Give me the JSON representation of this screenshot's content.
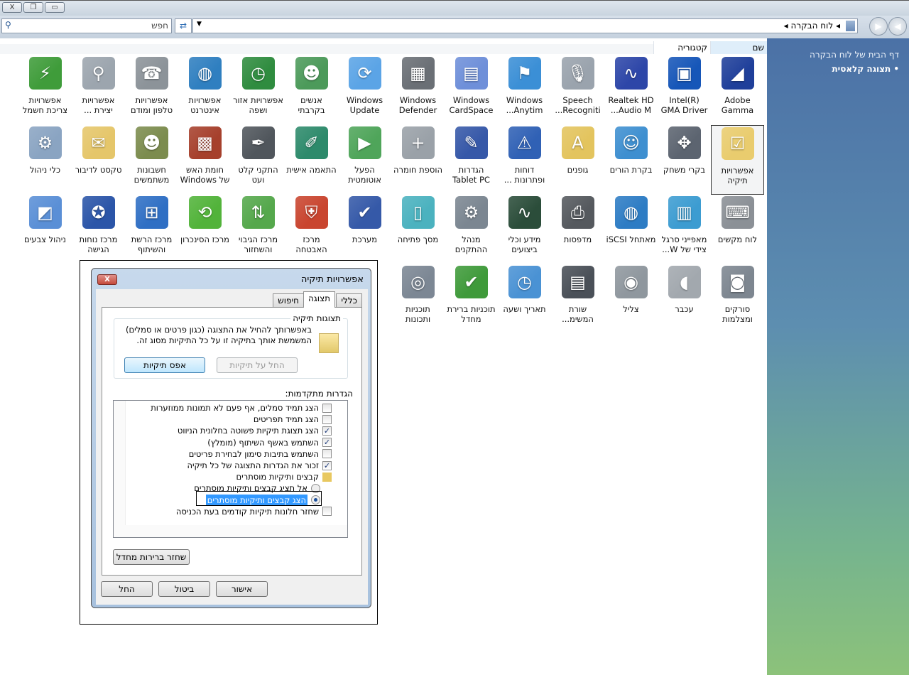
{
  "window": {
    "close": "X",
    "restore": "❐",
    "minimize": "▭"
  },
  "toolbar": {
    "search_placeholder": "חפש",
    "breadcrumb": "לוח הבקרה",
    "back": "◀",
    "forward": "▶"
  },
  "columns": {
    "name": "שם",
    "category": "קטגוריה"
  },
  "sidebar": {
    "home_link": "דף הבית של לוח הבקרה",
    "classic_view": "תצוגה קלאסית"
  },
  "items": [
    {
      "label": "Adobe Gamma",
      "icon": "monitor-icon",
      "glyph": "◢",
      "color": "#1f3f9a"
    },
    {
      "label": "Intel(R) GMA Driver",
      "icon": "intel-gma-icon",
      "glyph": "▣",
      "color": "#1656b8"
    },
    {
      "label": "Realtek HD Audio M...",
      "icon": "realtek-icon",
      "glyph": "∿",
      "color": "#2d46a8"
    },
    {
      "label": "Speech Recogniti...",
      "icon": "microphone-icon",
      "glyph": "🎙",
      "color": "#9aa3ad"
    },
    {
      "label": "Windows Anytim...",
      "icon": "windows-flag-icon",
      "glyph": "⚑",
      "color": "#3b8fd6"
    },
    {
      "label": "Windows CardSpace",
      "icon": "cardspace-icon",
      "glyph": "▤",
      "color": "#6e8fd9"
    },
    {
      "label": "Windows Defender",
      "icon": "defender-wall-icon",
      "glyph": "▦",
      "color": "#6a6f75"
    },
    {
      "label": "Windows Update",
      "icon": "windows-update-icon",
      "glyph": "⟳",
      "color": "#5ba4e6"
    },
    {
      "label": "אנשים בקרבתי",
      "icon": "people-near-me-icon",
      "glyph": "☻",
      "color": "#4c9a5a"
    },
    {
      "label": "אפשרויות אזור ושפה",
      "icon": "globe-clock-icon",
      "glyph": "◷",
      "color": "#2f8c3f"
    },
    {
      "label": "אפשרויות אינטרנט",
      "icon": "globe-doc-icon",
      "glyph": "◍",
      "color": "#2f7fc0"
    },
    {
      "label": "אפשרויות טלפון ומודם",
      "icon": "phone-icon",
      "glyph": "☎",
      "color": "#8c9399"
    },
    {
      "label": "אפשרויות יצירת ...",
      "icon": "indexing-icon",
      "glyph": "⚲",
      "color": "#9ca5ae"
    },
    {
      "label": "אפשרויות צריכת חשמל",
      "icon": "power-battery-icon",
      "glyph": "⚡",
      "color": "#3f9c3a"
    },
    {
      "label": "אפשרויות תיקיה",
      "icon": "folder-options-icon",
      "glyph": "☑",
      "color": "#e9cc6e",
      "selected": true
    },
    {
      "label": "בקרי משחק",
      "icon": "gamepad-icon",
      "glyph": "✥",
      "color": "#5c6470"
    },
    {
      "label": "בקרת הורים",
      "icon": "parental-controls-icon",
      "glyph": "☺",
      "color": "#3e8fd0"
    },
    {
      "label": "גופנים",
      "icon": "fonts-icon",
      "glyph": "A",
      "color": "#e3c45e"
    },
    {
      "label": "דוחות ופתרונות ...",
      "icon": "problem-reports-icon",
      "glyph": "⚠",
      "color": "#3061b5"
    },
    {
      "label": "הגדרות Tablet PC",
      "icon": "tablet-icon",
      "glyph": "✎",
      "color": "#3658a8"
    },
    {
      "label": "הוספת חומרה",
      "icon": "add-hardware-icon",
      "glyph": "+",
      "color": "#9aa1a8"
    },
    {
      "label": "הפעל אוטומטית",
      "icon": "autoplay-icon",
      "glyph": "▶",
      "color": "#4fa55a"
    },
    {
      "label": "התאמה אישית",
      "icon": "personalization-icon",
      "glyph": "✐",
      "color": "#2d8a6b"
    },
    {
      "label": "התקני קלט ועט",
      "icon": "pen-icon",
      "glyph": "✒",
      "color": "#50565c"
    },
    {
      "label": "חומת האש של Windows",
      "icon": "firewall-icon",
      "glyph": "▩",
      "color": "#a6402c"
    },
    {
      "label": "חשבונות משתמשים",
      "icon": "users-icon",
      "glyph": "☻",
      "color": "#7c8c4e"
    },
    {
      "label": "טקסט לדיבור",
      "icon": "text-to-speech-icon",
      "glyph": "✉",
      "color": "#e5c66a"
    },
    {
      "label": "כלי ניהול",
      "icon": "admin-tools-icon",
      "glyph": "⚙",
      "color": "#8aa4c2"
    },
    {
      "label": "לוח מקשים",
      "icon": "keyboard-icon",
      "glyph": "⌨",
      "color": "#8b9096"
    },
    {
      "label": "מאפייני סרגל צידי של W...",
      "icon": "sidebar-icon",
      "glyph": "▥",
      "color": "#3c9cd1"
    },
    {
      "label": "מאתחל iSCSI",
      "icon": "iscsi-icon",
      "glyph": "◍",
      "color": "#2d7cc4"
    },
    {
      "label": "מדפסות",
      "icon": "printer-icon",
      "glyph": "⎙",
      "color": "#55595e"
    },
    {
      "label": "מידע וכלי ביצועים",
      "icon": "performance-icon",
      "glyph": "∿",
      "color": "#2b4d3a"
    },
    {
      "label": "מנהל ההתקנים",
      "icon": "device-manager-icon",
      "glyph": "⚙",
      "color": "#7b8691"
    },
    {
      "label": "מסך פתיחה",
      "icon": "welcome-center-icon",
      "glyph": "▯",
      "color": "#4bb2bf"
    },
    {
      "label": "מערכת",
      "icon": "system-icon",
      "glyph": "✔",
      "color": "#3559a8"
    },
    {
      "label": "מרכז האבטחה",
      "icon": "security-center-icon",
      "glyph": "⛨",
      "color": "#c9452f"
    },
    {
      "label": "מרכז הגיבוי והשחזור",
      "icon": "backup-icon",
      "glyph": "⇅",
      "color": "#55a84c"
    },
    {
      "label": "מרכז הסינכרון",
      "icon": "sync-center-icon",
      "glyph": "⟲",
      "color": "#52b33a"
    },
    {
      "label": "מרכז הרשת והשיתוף",
      "icon": "network-icon",
      "glyph": "⊞",
      "color": "#2f6fc4"
    },
    {
      "label": "מרכז נוחות הגישה",
      "icon": "ease-of-access-icon",
      "glyph": "✪",
      "color": "#2b55a8"
    },
    {
      "label": "ניהול צבעים",
      "icon": "color-management-icon",
      "glyph": "◩",
      "color": "#5a8fd6"
    },
    {
      "label": "סורקים ומצלמות",
      "icon": "scanner-camera-icon",
      "glyph": "◙",
      "color": "#7d8690"
    },
    {
      "label": "עכבר",
      "icon": "mouse-icon",
      "glyph": "◖",
      "color": "#a2a8ae"
    },
    {
      "label": "צליל",
      "icon": "speaker-icon",
      "glyph": "◉",
      "color": "#8f979e"
    },
    {
      "label": "שורת המשימ...",
      "icon": "taskbar-icon",
      "glyph": "▤",
      "color": "#4a5058"
    },
    {
      "label": "תאריך ושעה",
      "icon": "date-time-icon",
      "glyph": "◷",
      "color": "#4a92d4"
    },
    {
      "label": "תוכניות ברירת מחדל",
      "icon": "default-programs-icon",
      "glyph": "✔",
      "color": "#3f9a3a"
    },
    {
      "label": "תוכניות ותכונות",
      "icon": "programs-features-icon",
      "glyph": "◎",
      "color": "#7c8794"
    }
  ],
  "dialog": {
    "title": "אפשרויות תיקיה",
    "close": "X",
    "tabs": [
      "כללי",
      "תצוגה",
      "חיפוש"
    ],
    "group_title": "תצוגות תיקיה",
    "group_desc": "באפשרותך להחיל את התצוגה (כגון פרטים או סמלים) המשמשת אותך בתיקיה זו על כל התיקיות מסוג זה.",
    "apply_to_folders": "החל על תיקיות",
    "reset_folders": "אפס תיקיות",
    "advanced_label": "הגדרות מתקדמות:",
    "settings": [
      {
        "label": "הצג תמיד סמלים, אף פעם לא תמונות ממוזערות",
        "type": "checkbox",
        "checked": false
      },
      {
        "label": "הצג תמיד תפריטים",
        "type": "checkbox",
        "checked": false
      },
      {
        "label": "הצג תצוגת תיקיות פשוטה בחלונית הניווט",
        "type": "checkbox",
        "checked": true
      },
      {
        "label": "השתמש באשף השיתוף (מומלץ)",
        "type": "checkbox",
        "checked": true
      },
      {
        "label": "השתמש בתיבות סימון לבחירת פריטים",
        "type": "checkbox",
        "checked": false
      },
      {
        "label": "זכור את הגדרות התצוגה של כל תיקיה",
        "type": "checkbox",
        "checked": true
      },
      {
        "label": "קבצים ותיקיות מוסתרים",
        "type": "folder"
      },
      {
        "label": "אל תציג קבצים ותיקיות מוסתרים",
        "type": "radio",
        "checked": false
      },
      {
        "label": "הצג קבצים ותיקיות מוסתרים",
        "type": "radio",
        "checked": true
      },
      {
        "label": "שחזר חלונות תיקיות קודמים בעת הכניסה",
        "type": "checkbox",
        "checked": false
      }
    ],
    "restore_defaults": "שחזר ברירות מחדל",
    "ok": "אישור",
    "cancel": "ביטול",
    "apply": "החל"
  }
}
